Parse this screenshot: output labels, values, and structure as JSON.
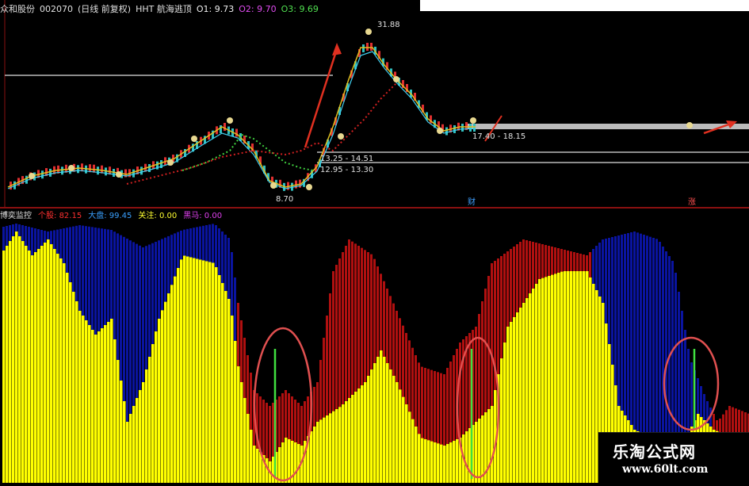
{
  "header": {
    "stock_name": "众和股份",
    "stock_code": "002070",
    "mode": "(日线 前复权)",
    "indicator": "HHT 航海逃顶",
    "o1": "O1: 9.73",
    "o2": "O2: 9.70",
    "o3": "O3: 9.69"
  },
  "indicator_bar": {
    "name": "博奕监控",
    "item1_label": "个股",
    "item1_value": "82.15",
    "item2_label": "大盘",
    "item2_value": "99.45",
    "item3_label": "关注",
    "item3_value": "0.00",
    "item4_label": "黑马",
    "item4_value": "0.00"
  },
  "price_labels": {
    "high": "31.88",
    "low": "8.70",
    "range1": "17.40 - 18.15",
    "range2": "13.25 - 14.51",
    "range3": "12.95 - 13.30",
    "marker1": "财",
    "marker2": "涨"
  },
  "watermark": {
    "site_cn": "乐淘公式网",
    "url": "www.60lt.com"
  },
  "colors": {
    "yellow": "#ffff00",
    "blue": "#0a14a0",
    "red": "#b01010",
    "green": "#40e040",
    "circle": "#e05050",
    "arrow": "#e03020"
  }
}
